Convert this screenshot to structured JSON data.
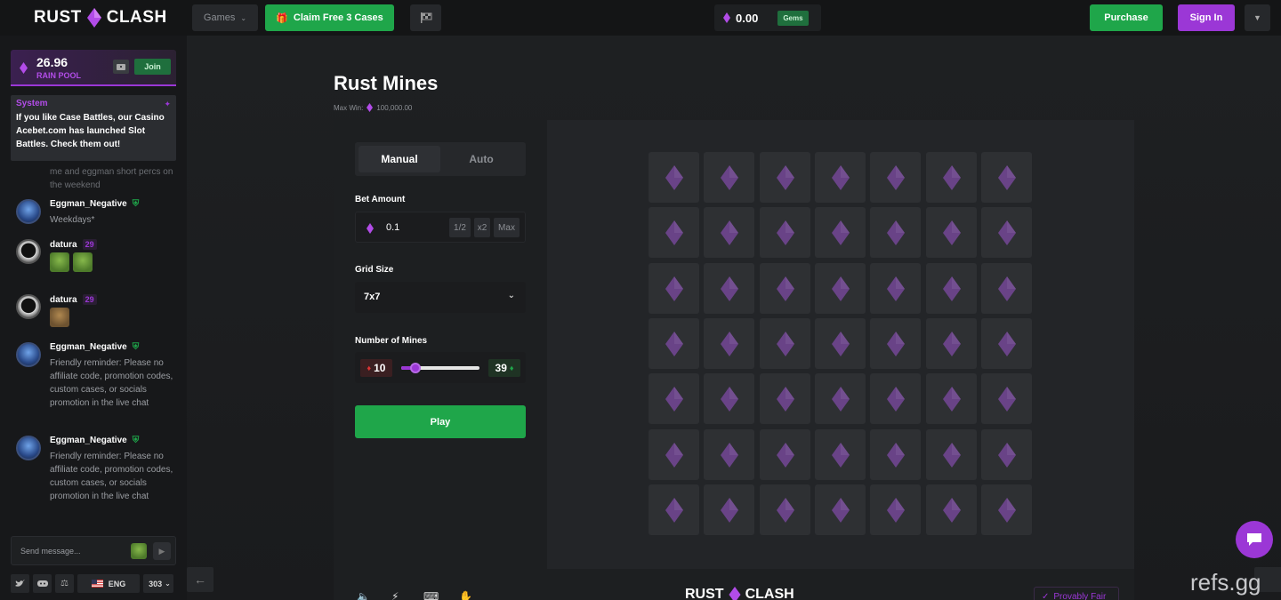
{
  "header": {
    "logo_left": "RUST",
    "logo_right": "CLASH",
    "games_label": "Games",
    "claim_label": "Claim Free 3 Cases",
    "balance": "0.00",
    "balance_unit": "Gems",
    "purchase_label": "Purchase",
    "signin_label": "Sign In"
  },
  "sidebar": {
    "rain_amount": "26.96",
    "rain_label": "RAIN POOL",
    "join_label": "Join",
    "system": {
      "title": "System",
      "text": "If you like Case Battles, our Casino Acebet.com has launched Slot Battles. Check them out!"
    },
    "faded_text": "me and eggman short percs on the weekend",
    "messages": [
      {
        "name": "Eggman_Negative",
        "level": "",
        "text": "Weekdays*"
      },
      {
        "name": "datura",
        "level": "29",
        "text": ""
      },
      {
        "name": "datura",
        "level": "29",
        "text": ""
      },
      {
        "name": "Eggman_Negative",
        "level": "",
        "text": "Friendly reminder: Please no affiliate code, promotion codes, custom cases, or socials promotion in the live chat"
      },
      {
        "name": "Eggman_Negative",
        "level": "",
        "text": "Friendly reminder: Please no affiliate code, promotion codes, custom cases, or socials promotion in the live chat"
      }
    ],
    "input_placeholder": "Send message...",
    "language": "ENG",
    "online_count": "303"
  },
  "game": {
    "title": "Rust Mines",
    "max_win_label": "Max Win:",
    "max_win_value": "100,000.00",
    "tabs": [
      "Manual",
      "Auto"
    ],
    "bet_label": "Bet Amount",
    "bet_value": "0.1",
    "bet_half": "1/2",
    "bet_double": "x2",
    "bet_max": "Max",
    "grid_label": "Grid Size",
    "grid_value": "7x7",
    "mines_label": "Number of Mines",
    "mines_value": "10",
    "gems_value": "39",
    "mines_fraction": 0.18,
    "play_label": "Play",
    "grid_rows": 7,
    "grid_cols": 7,
    "footer_logo_left": "RUST",
    "footer_logo_right": "CLASH",
    "fair_label": "Provably Fair"
  },
  "watermark": "refs.gg",
  "colors": {
    "accent": "#9b37d6",
    "green": "#1fa64a",
    "tile": "#2e3033",
    "gem": "#7d4aa3"
  }
}
